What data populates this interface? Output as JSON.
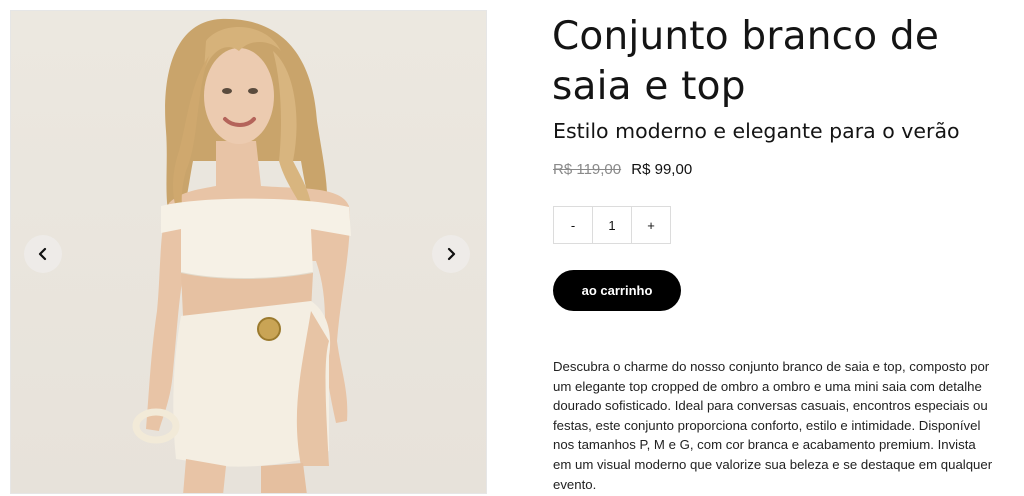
{
  "product": {
    "title": "Conjunto branco de saia e top",
    "subtitle": "Estilo moderno e elegante para o verão",
    "price_old": "R$ 119,00",
    "price_new": "R$ 99,00",
    "quantity": "1",
    "qty_minus": "-",
    "qty_plus": "+",
    "cart_button": "ao carrinho",
    "description": "Descubra o charme do nosso conjunto branco de saia e top, composto por um elegante top cropped de ombro a ombro e uma mini saia com detalhe dourado sofisticado. Ideal para conversas casuais, encontros especiais ou festas, este conjunto proporciona conforto, estilo e intimidade. Disponível nos tamanhos P, M e G, com cor branca e acabamento premium. Invista em um visual moderno que valorize sua beleza e se destaque em qualquer evento."
  },
  "gallery": {
    "prev_icon": "chevron-left-icon",
    "next_icon": "chevron-right-icon"
  },
  "colors": {
    "button_bg": "#000000",
    "button_text": "#ffffff",
    "old_price": "#8a8a8a"
  }
}
